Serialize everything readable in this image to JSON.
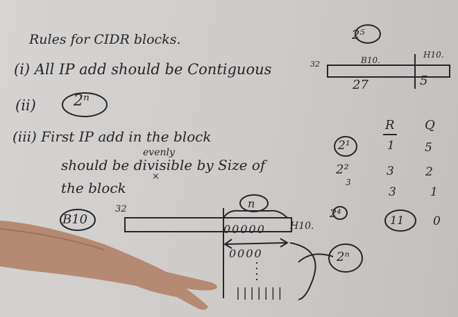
{
  "board": {
    "title": "Rules for CIDR blocks.",
    "rule1": "(i) All IP add should be Contiguous",
    "rule2_marker": "(ii)",
    "rule2_value": "2ⁿ",
    "rule3_line1": "(iii) First IP add in the block",
    "rule3_line2": "should be divisible by Size of",
    "rule3_line3": "the block",
    "rule3_insert": "evenly",
    "caret_mark": "×"
  },
  "block_diagram": {
    "label": "B10",
    "bits_left": "32",
    "host_bits_label": "n",
    "host_zeros": "00000",
    "host_label": "H10.",
    "range_zeros": "0000",
    "size_label": "2ⁿ",
    "ticks": "|||||||"
  },
  "right_panel": {
    "power": "2⁵",
    "bits_left": "32",
    "network_label": "B10.",
    "host_label": "H10.",
    "network_bits": "27",
    "host_bits": "5",
    "col_r": "R",
    "col_q": "Q",
    "row1_power": "2¹",
    "row1_r": "1",
    "row1_q": "5",
    "row2_power": "2²",
    "row2_r": "3",
    "row2_q": "2",
    "row3_power": "3",
    "row3_r": "3",
    "row3_q": "1",
    "row4_power": "2⁴",
    "row4_r": "11",
    "row4_q": "0"
  }
}
